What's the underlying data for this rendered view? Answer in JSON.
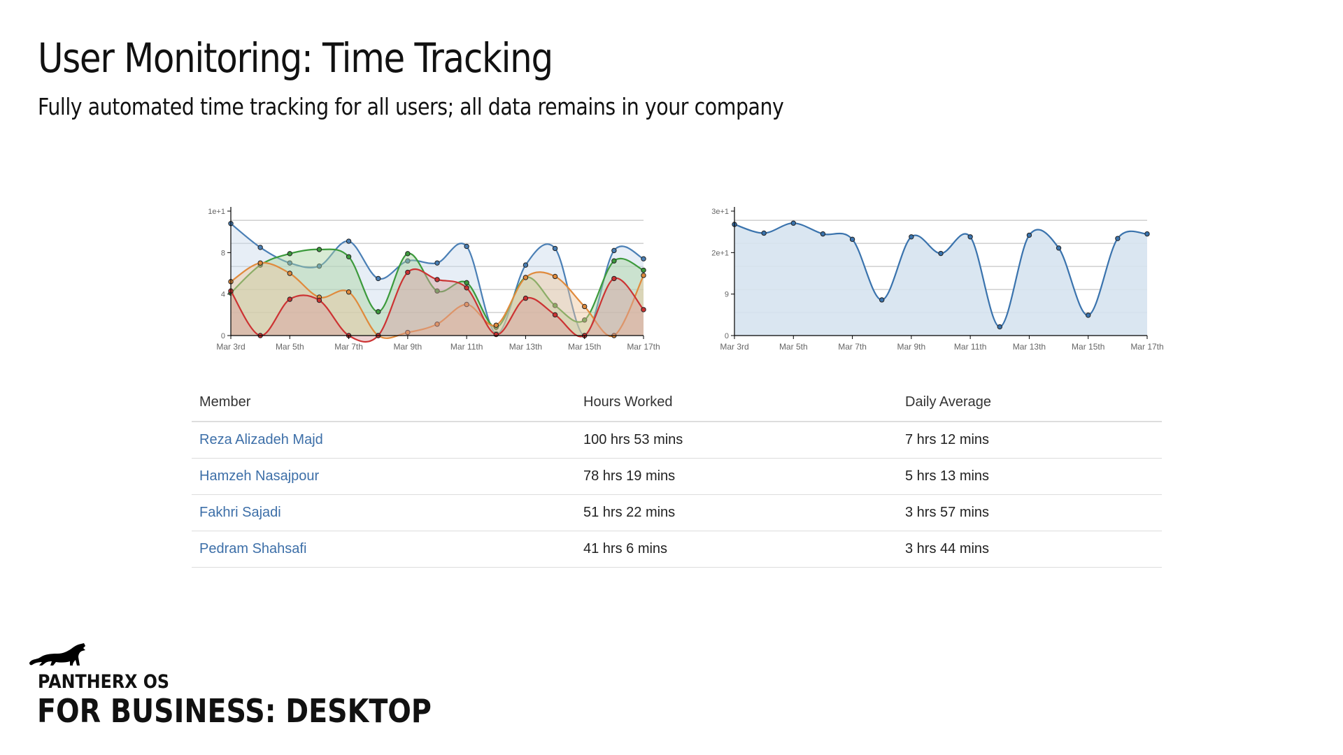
{
  "header": {
    "title": "User Monitoring: Time Tracking",
    "subtitle": "Fully automated time tracking for all users; all data remains in your company"
  },
  "chart_data": [
    {
      "type": "area",
      "x": [
        "Mar 3rd",
        "Mar 4th",
        "Mar 5th",
        "Mar 6th",
        "Mar 7th",
        "Mar 8th",
        "Mar 9th",
        "Mar 10th",
        "Mar 11th",
        "Mar 12th",
        "Mar 13th",
        "Mar 14th",
        "Mar 15th",
        "Mar 16th",
        "Mar 17th"
      ],
      "x_tick_labels": [
        "Mar 3rd",
        "Mar 5th",
        "Mar 7th",
        "Mar 9th",
        "Mar 11th",
        "Mar 13th",
        "Mar 15th",
        "Mar 17th"
      ],
      "y_tick_labels": [
        "0",
        "4",
        "8",
        "1e+1"
      ],
      "ylim": [
        0,
        12
      ],
      "grid": true,
      "series": [
        {
          "color": "#4a7fb5",
          "fill": "#c9d9ea",
          "values": [
            10.8,
            8.5,
            7.0,
            6.7,
            9.1,
            5.5,
            7.2,
            7.0,
            8.6,
            0.2,
            6.8,
            8.4,
            0,
            8.2,
            7.4
          ]
        },
        {
          "color": "#3c9a3c",
          "fill": "#a9d3a0",
          "values": [
            4.1,
            6.8,
            7.9,
            8.3,
            7.6,
            2.3,
            7.9,
            4.3,
            5.1,
            0.8,
            5.6,
            2.9,
            1.5,
            7.2,
            6.3
          ]
        },
        {
          "color": "#e08a3c",
          "fill": "#edc69b",
          "values": [
            5.2,
            7.0,
            6.0,
            3.7,
            4.2,
            0,
            0.3,
            1.1,
            3.0,
            1.0,
            5.6,
            5.7,
            2.8,
            0,
            5.8
          ]
        },
        {
          "color": "#cc3333",
          "fill": "#d9a0a0",
          "values": [
            4.3,
            0,
            3.5,
            3.4,
            0,
            0,
            6.1,
            5.4,
            4.6,
            0.1,
            3.6,
            2.0,
            0,
            5.5,
            2.5
          ]
        }
      ]
    },
    {
      "type": "area",
      "x": [
        "Mar 3rd",
        "Mar 4th",
        "Mar 5th",
        "Mar 6th",
        "Mar 7th",
        "Mar 8th",
        "Mar 9th",
        "Mar 10th",
        "Mar 11th",
        "Mar 12th",
        "Mar 13th",
        "Mar 14th",
        "Mar 15th",
        "Mar 16th",
        "Mar 17th"
      ],
      "x_tick_labels": [
        "Mar 3rd",
        "Mar 5th",
        "Mar 7th",
        "Mar 9th",
        "Mar 11th",
        "Mar 13th",
        "Mar 15th",
        "Mar 17th"
      ],
      "y_tick_labels": [
        "0",
        "9",
        "2e+1",
        "3e+1"
      ],
      "ylim": [
        0,
        30
      ],
      "grid": true,
      "series": [
        {
          "color": "#3a73ad",
          "fill": "#d6e3ef",
          "values": [
            26.8,
            24.7,
            27.1,
            24.5,
            23.2,
            8.6,
            23.8,
            19.8,
            23.8,
            2.1,
            24.2,
            21.1,
            4.9,
            23.4,
            24.5
          ]
        }
      ]
    }
  ],
  "table": {
    "headers": [
      "Member",
      "Hours Worked",
      "Daily Average"
    ],
    "rows": [
      {
        "member": "Reza Alizadeh Majd",
        "hours": "100 hrs 53 mins",
        "avg": "7 hrs 12 mins"
      },
      {
        "member": "Hamzeh Nasajpour",
        "hours": "78 hrs 19 mins",
        "avg": "5 hrs 13 mins"
      },
      {
        "member": "Fakhri Sajadi",
        "hours": "51 hrs 22 mins",
        "avg": "3 hrs 57 mins"
      },
      {
        "member": "Pedram Shahsafi",
        "hours": "41 hrs 6 mins",
        "avg": "3 hrs 44 mins"
      }
    ]
  },
  "brand": {
    "icon": "panther-logo",
    "line1": "PANTHERX OS",
    "line2": "FOR BUSINESS: DESKTOP"
  }
}
